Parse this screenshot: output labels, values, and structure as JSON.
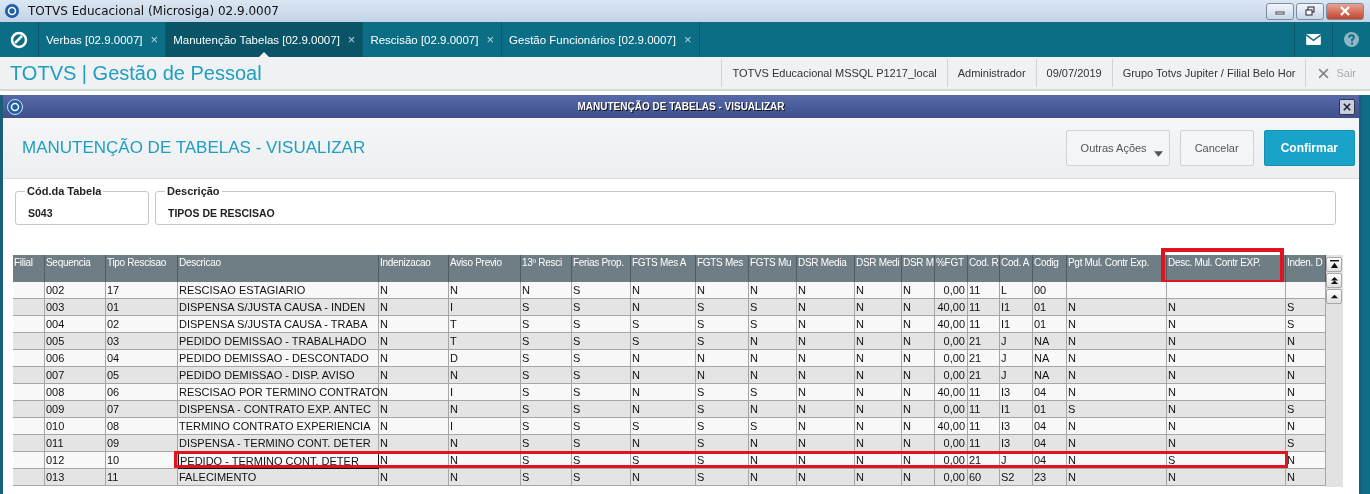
{
  "window": {
    "title": "TOTVS Educacional (Microsiga) 02.9.0007"
  },
  "tabs": [
    {
      "label": "Verbas [02.9.0007]",
      "selected": false
    },
    {
      "label": "Manutenção Tabelas [02.9.0007]",
      "selected": true
    },
    {
      "label": "Rescisão [02.9.0007]",
      "selected": false
    },
    {
      "label": "Gestão Funcionários [02.9.0007]",
      "selected": false
    }
  ],
  "tab_close": "×",
  "app_header": {
    "title": "TOTVS | Gestão de Pessoal",
    "info": [
      "TOTVS Educacional MSSQL P1217_local",
      "Administrador",
      "09/07/2019",
      "Grupo Totvs Jupiter / Filial Belo Hor"
    ],
    "logout": "Sair"
  },
  "dialog": {
    "title": "MANUTENÇÃO DE TABELAS - VISUALIZAR",
    "heading": "MANUTENÇÃO DE TABELAS - VISUALIZAR",
    "buttons": [
      {
        "label": "Outras Ações",
        "kind": "menu"
      },
      {
        "label": "Cancelar",
        "kind": "plain"
      },
      {
        "label": "Confirmar",
        "kind": "primary"
      }
    ],
    "fields": [
      {
        "label": "Cód.da Tabela",
        "value": "S043"
      },
      {
        "label": "Descrição",
        "value": "TIPOS DE RESCISAO"
      }
    ]
  },
  "table": {
    "columns": [
      {
        "label": "Filial",
        "highlighted": false
      },
      {
        "label": "Sequencia",
        "highlighted": false
      },
      {
        "label": "Tipo Rescisao",
        "highlighted": false
      },
      {
        "label": "Descricao",
        "highlighted": false
      },
      {
        "label": "Indenizacao",
        "highlighted": false
      },
      {
        "label": "Aviso Previo",
        "highlighted": false
      },
      {
        "label": "13º Resci",
        "highlighted": false
      },
      {
        "label": "Ferias Prop.",
        "highlighted": false
      },
      {
        "label": "FGTS Mes A",
        "highlighted": false
      },
      {
        "label": "FGTS Mes",
        "highlighted": false
      },
      {
        "label": "FGTS Mu",
        "highlighted": false
      },
      {
        "label": "DSR Media",
        "highlighted": false
      },
      {
        "label": "DSR Medi",
        "highlighted": false
      },
      {
        "label": "DSR M",
        "highlighted": false
      },
      {
        "label": "%FGT",
        "highlighted": false,
        "kind": "number"
      },
      {
        "label": "Cod. R",
        "highlighted": false
      },
      {
        "label": "Cod. A",
        "highlighted": false
      },
      {
        "label": "Codig",
        "highlighted": false
      },
      {
        "label": "Pgt Mul. Contr Exp.",
        "highlighted": false
      },
      {
        "label": "Desc. Mul. Contr EXP.",
        "highlighted": true
      },
      {
        "label": "Inden. D",
        "highlighted": false
      }
    ],
    "rows": [
      {
        "selected": false,
        "highlighted": false,
        "cells": [
          null,
          "002",
          "17",
          "RESCISAO ESTAGIARIO",
          "N",
          "N",
          "N",
          "S",
          "N",
          "N",
          "N",
          "N",
          "N",
          "N",
          "0,00",
          "11",
          "L",
          "00",
          null,
          null,
          null
        ]
      },
      {
        "selected": false,
        "highlighted": false,
        "cells": [
          null,
          "003",
          "01",
          "DISPENSA S/JUSTA CAUSA - INDEN",
          "N",
          "I",
          "S",
          "S",
          "N",
          "S",
          "S",
          "N",
          "N",
          "N",
          "40,00",
          "11",
          "I1",
          "01",
          "N",
          "N",
          "S"
        ]
      },
      {
        "selected": false,
        "highlighted": false,
        "cells": [
          null,
          "004",
          "02",
          "DISPENSA S/JUSTA CAUSA - TRABA",
          "N",
          "T",
          "S",
          "S",
          "S",
          "S",
          "S",
          "N",
          "N",
          "N",
          "40,00",
          "11",
          "I1",
          "01",
          "N",
          "N",
          "S"
        ]
      },
      {
        "selected": false,
        "highlighted": false,
        "cells": [
          null,
          "005",
          "03",
          "PEDIDO DEMISSAO - TRABALHADO",
          "N",
          "T",
          "S",
          "S",
          "S",
          "S",
          "N",
          "N",
          "N",
          "N",
          "0,00",
          "21",
          "J",
          "NA",
          "N",
          "N",
          "N"
        ]
      },
      {
        "selected": false,
        "highlighted": false,
        "cells": [
          null,
          "006",
          "04",
          "PEDIDO DEMISSAO - DESCONTADO",
          "N",
          "D",
          "S",
          "S",
          "N",
          "N",
          "N",
          "N",
          "N",
          "N",
          "0,00",
          "21",
          "J",
          "NA",
          "N",
          "N",
          "N"
        ]
      },
      {
        "selected": false,
        "highlighted": false,
        "cells": [
          null,
          "007",
          "05",
          "PEDIDO DEMISSAO - DISP. AVISO",
          "N",
          "N",
          "S",
          "S",
          "N",
          "N",
          "N",
          "N",
          "N",
          "N",
          "0,00",
          "21",
          "J",
          "NA",
          "N",
          "N",
          "N"
        ]
      },
      {
        "selected": false,
        "highlighted": false,
        "cells": [
          null,
          "008",
          "06",
          "RESCISAO POR TERMINO CONTRATO",
          "N",
          "I",
          "S",
          "S",
          "N",
          "S",
          "S",
          "N",
          "N",
          "N",
          "40,00",
          "11",
          "I3",
          "04",
          "N",
          "N",
          "N"
        ]
      },
      {
        "selected": false,
        "highlighted": false,
        "cells": [
          null,
          "009",
          "07",
          "DISPENSA - CONTRATO EXP. ANTEC",
          "N",
          "N",
          "S",
          "S",
          "N",
          "S",
          "N",
          "N",
          "N",
          "N",
          "0,00",
          "11",
          "I1",
          "01",
          "S",
          "N",
          "S"
        ]
      },
      {
        "selected": false,
        "highlighted": false,
        "cells": [
          null,
          "010",
          "08",
          "TERMINO CONTRATO EXPERIENCIA",
          "N",
          "I",
          "S",
          "S",
          "S",
          "S",
          "S",
          "N",
          "N",
          "N",
          "40,00",
          "11",
          "I3",
          "04",
          "N",
          "N",
          "N"
        ]
      },
      {
        "selected": false,
        "highlighted": false,
        "cells": [
          null,
          "011",
          "09",
          "DISPENSA - TERMINO CONT. DETER",
          "N",
          "N",
          "S",
          "S",
          "N",
          "S",
          "N",
          "N",
          "N",
          "N",
          "0,00",
          "11",
          "I3",
          "04",
          "N",
          "N",
          "S"
        ]
      },
      {
        "selected": true,
        "highlighted": true,
        "cells": [
          null,
          "012",
          "10",
          "PEDIDO - TERMINO CONT. DETER",
          "N",
          "N",
          "S",
          "S",
          "S",
          "S",
          "N",
          "N",
          "N",
          "N",
          "0,00",
          "21",
          "J",
          "04",
          "N",
          "S",
          "N"
        ]
      },
      {
        "selected": false,
        "highlighted": false,
        "cells": [
          null,
          "013",
          "11",
          "FALECIMENTO",
          "N",
          "N",
          "S",
          "S",
          "N",
          "S",
          "N",
          "N",
          "N",
          "N",
          "0,00",
          "60",
          "S2",
          "23",
          "N",
          "N",
          "N"
        ]
      }
    ]
  }
}
